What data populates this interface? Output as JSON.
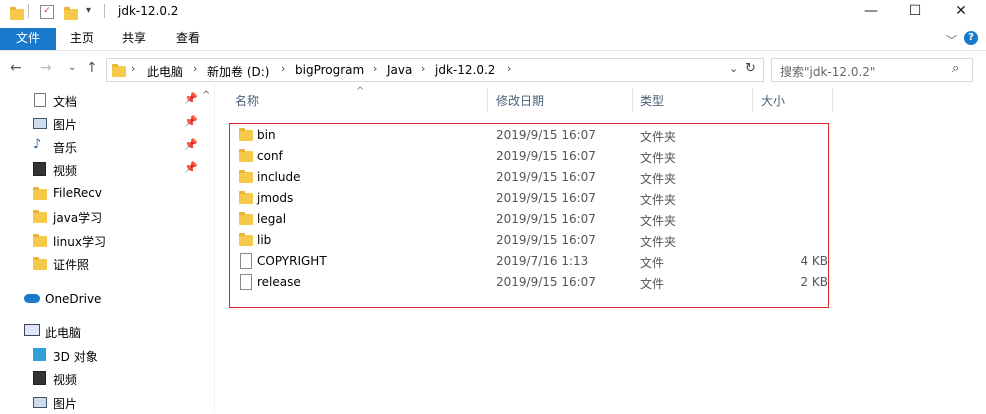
{
  "window": {
    "title": "jdk-12.0.2",
    "minimize": "—",
    "maximize": "☐",
    "close": "✕"
  },
  "ribbon": {
    "tabs": [
      "文件",
      "主页",
      "共享",
      "查看"
    ],
    "help": "?"
  },
  "address": {
    "crumbs": [
      "此电脑",
      "新加卷 (D:)",
      "bigProgram",
      "Java",
      "jdk-12.0.2"
    ],
    "search_placeholder": "搜索\"jdk-12.0.2\""
  },
  "nav": {
    "quick": [
      {
        "label": "文档",
        "icon": "document-icon",
        "pinned": true
      },
      {
        "label": "图片",
        "icon": "picture-icon",
        "pinned": true
      },
      {
        "label": "音乐",
        "icon": "music-icon",
        "pinned": true
      },
      {
        "label": "视频",
        "icon": "video-icon",
        "pinned": true
      },
      {
        "label": "FileRecv",
        "icon": "folder-icon",
        "pinned": false
      },
      {
        "label": "java学习",
        "icon": "folder-icon",
        "pinned": false
      },
      {
        "label": "linux学习",
        "icon": "folder-icon",
        "pinned": false
      },
      {
        "label": "证件照",
        "icon": "folder-icon",
        "pinned": false
      }
    ],
    "onedrive": "OneDrive",
    "thispc": "此电脑",
    "pc_items": [
      {
        "label": "3D 对象",
        "icon": "cube-icon"
      },
      {
        "label": "视频",
        "icon": "video-icon"
      },
      {
        "label": "图片",
        "icon": "picture-icon"
      }
    ]
  },
  "list": {
    "columns": [
      "名称",
      "修改日期",
      "类型",
      "大小"
    ],
    "rows": [
      {
        "name": "bin",
        "date": "2019/9/15 16:07",
        "type": "文件夹",
        "size": "",
        "kind": "folder"
      },
      {
        "name": "conf",
        "date": "2019/9/15 16:07",
        "type": "文件夹",
        "size": "",
        "kind": "folder"
      },
      {
        "name": "include",
        "date": "2019/9/15 16:07",
        "type": "文件夹",
        "size": "",
        "kind": "folder"
      },
      {
        "name": "jmods",
        "date": "2019/9/15 16:07",
        "type": "文件夹",
        "size": "",
        "kind": "folder"
      },
      {
        "name": "legal",
        "date": "2019/9/15 16:07",
        "type": "文件夹",
        "size": "",
        "kind": "folder"
      },
      {
        "name": "lib",
        "date": "2019/9/15 16:07",
        "type": "文件夹",
        "size": "",
        "kind": "folder"
      },
      {
        "name": "COPYRIGHT",
        "date": "2019/7/16 1:13",
        "type": "文件",
        "size": "4 KB",
        "kind": "file"
      },
      {
        "name": "release",
        "date": "2019/9/15 16:07",
        "type": "文件",
        "size": "2 KB",
        "kind": "file"
      }
    ]
  },
  "colors": {
    "accent": "#1979ca",
    "highlight": "#e0262d",
    "folder": "#f6c94a"
  }
}
